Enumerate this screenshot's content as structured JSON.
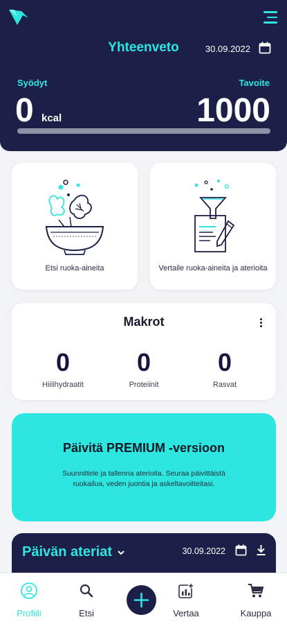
{
  "header": {
    "title": "Yhteenveto",
    "date": "30.09.2022",
    "eaten_label": "Syödyt",
    "eaten_value": "0",
    "eaten_unit": "kcal",
    "goal_label": "Tavoite",
    "goal_value": "1000",
    "progress_fraction": 0
  },
  "tiles": {
    "search_label": "Etsi ruoka-aineita",
    "compare_label": "Vertaile ruoka-aineita ja aterioita"
  },
  "macros": {
    "title": "Makrot",
    "items": [
      {
        "value": "0",
        "label": "Hiilihydraatit"
      },
      {
        "value": "0",
        "label": "Proteiinit"
      },
      {
        "value": "0",
        "label": "Rasvat"
      }
    ]
  },
  "premium": {
    "title": "Päivitä PREMIUM -versioon",
    "text": "Suunnittele ja tallenna aterioita. Seuraa päivittäistä ruokailua, veden juontia ja askeltavoitteitasi."
  },
  "meals": {
    "title": "Päivän ateriat",
    "date": "30.09.2022"
  },
  "nav": {
    "items": [
      {
        "label": "Profiili",
        "icon": "profile-icon",
        "active": true
      },
      {
        "label": "Etsi",
        "icon": "search-icon",
        "active": false
      },
      {
        "label": "",
        "icon": "add-icon",
        "active": false
      },
      {
        "label": "Vertaa",
        "icon": "compare-chart-icon",
        "active": false
      },
      {
        "label": "Kauppa",
        "icon": "cart-icon",
        "active": false
      }
    ]
  },
  "colors": {
    "navy": "#1c2048",
    "accent": "#2ee6e0",
    "background": "#f2f3f5"
  }
}
